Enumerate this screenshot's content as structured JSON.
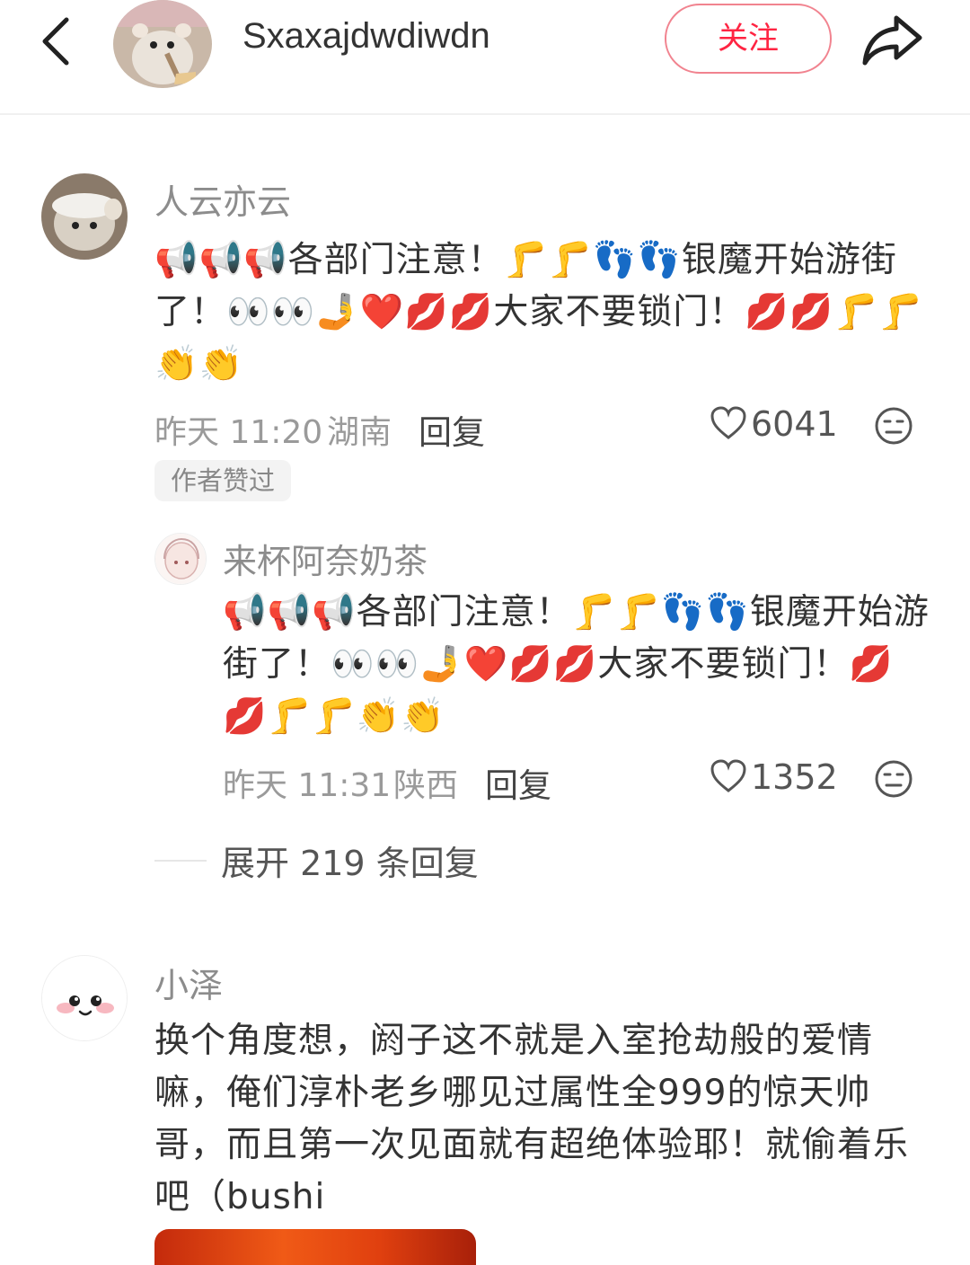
{
  "header": {
    "author_name": "Sxaxajdwdiwdn",
    "follow_label": "关注"
  },
  "comments": [
    {
      "user": "人云亦云",
      "text": "📢📢📢各部门注意！🦵🦵👣👣银魔开始游街了！👀👀🤳❤️💋💋大家不要锁门！💋💋🦵🦵👏👏",
      "time": "昨天 11:20",
      "location": "湖南",
      "reply_label": "回复",
      "likes": "6041",
      "badge": "作者赞过",
      "replies": [
        {
          "user": "来杯阿奈奶茶",
          "text": "📢📢📢各部门注意！🦵🦵👣👣银魔开始游街了！👀👀🤳❤️💋💋大家不要锁门！💋💋🦵🦵👏👏",
          "time": "昨天 11:31",
          "location": "陕西",
          "reply_label": "回复",
          "likes": "1352"
        }
      ],
      "expand_label": "展开 219 条回复"
    },
    {
      "user": "小泽",
      "text": "换个角度想，阏子这不就是入室抢劫般的爱情嘛，俺们淳朴老乡哪见过属性全999的惊天帅哥，而且第一次见面就有超绝体验耶！就偷着乐吧（bushi"
    }
  ],
  "icons": {
    "back": "chevron-left-icon",
    "share": "share-arrow-icon",
    "like": "heart-outline-icon",
    "reaction": "neutral-face-icon"
  },
  "colors": {
    "accent": "#ff2442",
    "follow_border": "#f1838f",
    "muted_text": "#9a9a9a"
  }
}
